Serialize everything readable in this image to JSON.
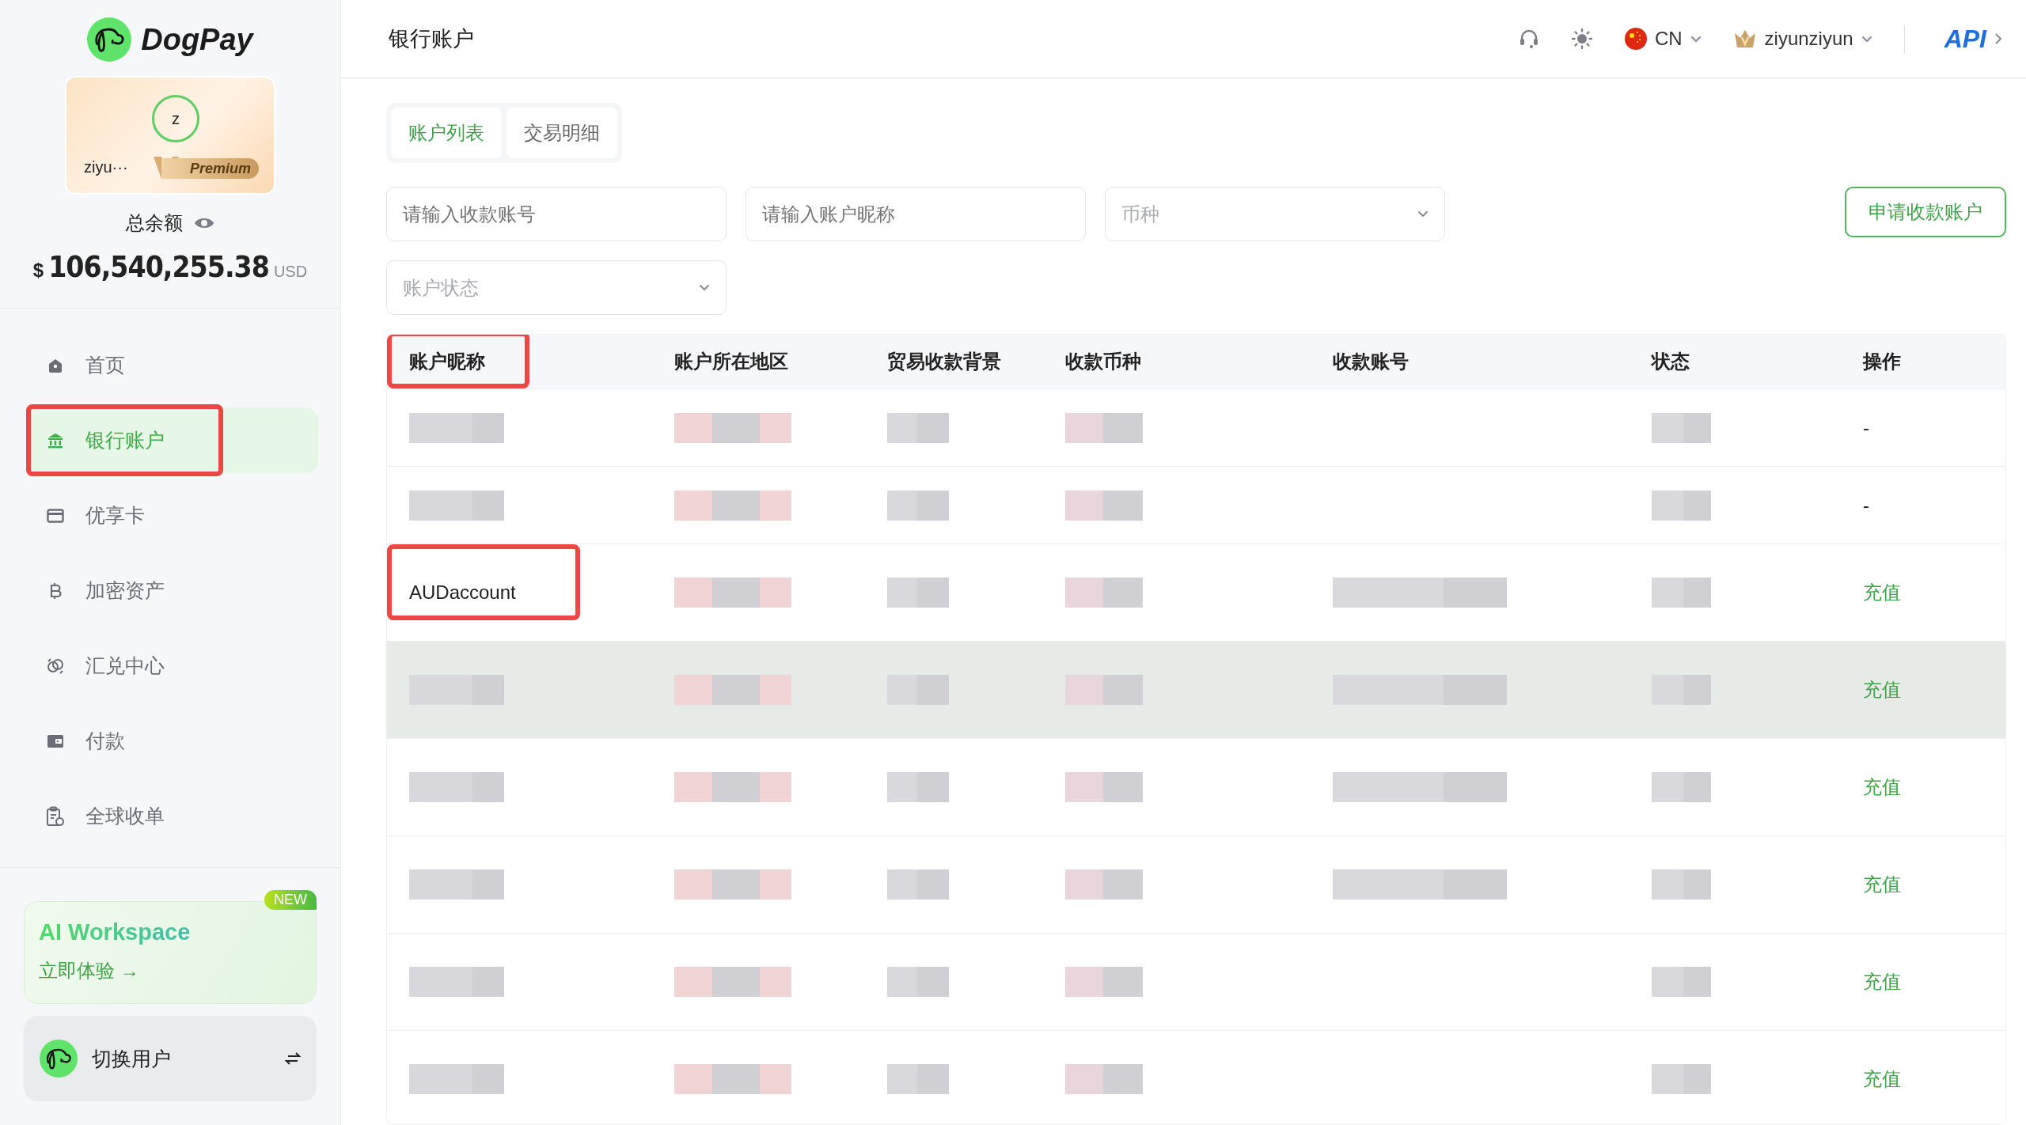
{
  "sidebar": {
    "brand": "DogPay",
    "profile": {
      "avatar_letter": "z",
      "name": "ziyu···",
      "badge": "Premium"
    },
    "balance": {
      "label": "总余额",
      "currency_symbol": "$",
      "amount": "106,540,255.38",
      "currency": "USD"
    },
    "nav": [
      {
        "label": "首页",
        "selected": false,
        "annotated": false
      },
      {
        "label": "银行账户",
        "selected": true,
        "annotated": true
      },
      {
        "label": "优享卡",
        "selected": false,
        "annotated": false
      },
      {
        "label": "加密资产",
        "selected": false,
        "annotated": false
      },
      {
        "label": "汇兑中心",
        "selected": false,
        "annotated": false
      },
      {
        "label": "付款",
        "selected": false,
        "annotated": false
      },
      {
        "label": "全球收单",
        "selected": false,
        "annotated": false
      }
    ],
    "promo": {
      "title": "AI Workspace",
      "link": "立即体验 →",
      "badge": "NEW"
    },
    "switch_user": {
      "label": "切换用户"
    }
  },
  "header": {
    "title": "银行账户",
    "language": "CN",
    "user": "ziyunziyun",
    "api": "API"
  },
  "tabs": [
    {
      "label": "账户列表",
      "selected": true
    },
    {
      "label": "交易明细",
      "selected": false
    }
  ],
  "filters": [
    {
      "kind": "input",
      "placeholder": "请输入收款账号"
    },
    {
      "kind": "input",
      "placeholder": "请输入账户昵称"
    },
    {
      "kind": "select",
      "placeholder": "币种"
    },
    {
      "kind": "select",
      "placeholder": "账户状态"
    }
  ],
  "apply_button": "申请收款账户",
  "table": {
    "columns": [
      {
        "label": "账户昵称",
        "annotated": true
      },
      {
        "label": "账户所在地区",
        "annotated": false
      },
      {
        "label": "贸易收款背景",
        "annotated": false
      },
      {
        "label": "收款币种",
        "annotated": false
      },
      {
        "label": "收款账号",
        "annotated": false
      },
      {
        "label": "状态",
        "annotated": false
      },
      {
        "label": "操作",
        "annotated": false
      }
    ],
    "rows": [
      {
        "hovered": false,
        "cells": [
          {
            "kind": "blurred",
            "annotated": false
          },
          {
            "kind": "blurred",
            "annotated": false
          },
          {
            "kind": "blurred",
            "annotated": false
          },
          {
            "kind": "blurred",
            "annotated": false
          },
          {
            "kind": "empty",
            "annotated": false
          },
          {
            "kind": "blurred",
            "annotated": false
          },
          {
            "kind": "text",
            "text": "-",
            "annotated": false
          }
        ]
      },
      {
        "hovered": false,
        "cells": [
          {
            "kind": "blurred",
            "annotated": false
          },
          {
            "kind": "blurred",
            "annotated": false
          },
          {
            "kind": "blurred",
            "annotated": false
          },
          {
            "kind": "blurred",
            "annotated": false
          },
          {
            "kind": "empty",
            "annotated": false
          },
          {
            "kind": "blurred",
            "annotated": false
          },
          {
            "kind": "text",
            "text": "-",
            "annotated": false
          }
        ]
      },
      {
        "hovered": false,
        "cells": [
          {
            "kind": "text",
            "text": "AUDaccount",
            "annotated": true
          },
          {
            "kind": "blurred",
            "annotated": false
          },
          {
            "kind": "blurred",
            "annotated": false
          },
          {
            "kind": "blurred",
            "annotated": false
          },
          {
            "kind": "blurred",
            "annotated": false
          },
          {
            "kind": "blurred",
            "annotated": false
          },
          {
            "kind": "link",
            "text": "充值",
            "annotated": false
          }
        ]
      },
      {
        "hovered": true,
        "cells": [
          {
            "kind": "blurred",
            "annotated": false
          },
          {
            "kind": "blurred",
            "annotated": false
          },
          {
            "kind": "blurred",
            "annotated": false
          },
          {
            "kind": "blurred",
            "annotated": false
          },
          {
            "kind": "blurred",
            "annotated": false
          },
          {
            "kind": "blurred",
            "annotated": false
          },
          {
            "kind": "link",
            "text": "充值",
            "annotated": false
          }
        ]
      },
      {
        "hovered": false,
        "cells": [
          {
            "kind": "blurred",
            "annotated": false
          },
          {
            "kind": "blurred",
            "annotated": false
          },
          {
            "kind": "blurred",
            "annotated": false
          },
          {
            "kind": "blurred",
            "annotated": false
          },
          {
            "kind": "blurred",
            "annotated": false
          },
          {
            "kind": "blurred",
            "annotated": false
          },
          {
            "kind": "link",
            "text": "充值",
            "annotated": false
          }
        ]
      },
      {
        "hovered": false,
        "cells": [
          {
            "kind": "blurred",
            "annotated": false
          },
          {
            "kind": "blurred",
            "annotated": false
          },
          {
            "kind": "blurred",
            "annotated": false
          },
          {
            "kind": "blurred",
            "annotated": false
          },
          {
            "kind": "blurred",
            "annotated": false
          },
          {
            "kind": "blurred",
            "annotated": false
          },
          {
            "kind": "link",
            "text": "充值",
            "annotated": false
          }
        ]
      },
      {
        "hovered": false,
        "cells": [
          {
            "kind": "blurred",
            "annotated": false
          },
          {
            "kind": "blurred",
            "annotated": false
          },
          {
            "kind": "blurred",
            "annotated": false
          },
          {
            "kind": "blurred",
            "annotated": false
          },
          {
            "kind": "empty",
            "annotated": false
          },
          {
            "kind": "blurred",
            "annotated": false
          },
          {
            "kind": "link",
            "text": "充值",
            "annotated": false
          }
        ]
      },
      {
        "hovered": false,
        "cells": [
          {
            "kind": "blurred",
            "annotated": false
          },
          {
            "kind": "blurred",
            "annotated": false
          },
          {
            "kind": "blurred",
            "annotated": false
          },
          {
            "kind": "blurred",
            "annotated": false
          },
          {
            "kind": "empty",
            "annotated": false
          },
          {
            "kind": "blurred",
            "annotated": false
          },
          {
            "kind": "link",
            "text": "充值",
            "annotated": false
          }
        ]
      }
    ]
  }
}
